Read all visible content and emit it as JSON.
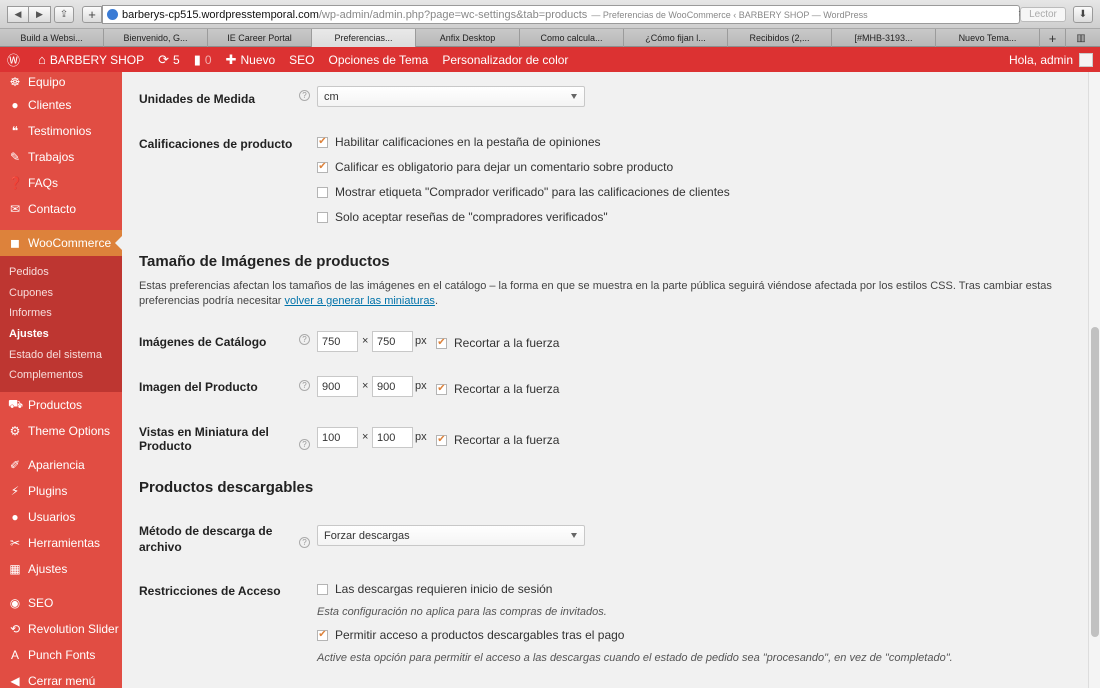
{
  "browser": {
    "url_host": "barberys-cp515.wordpresstemporal.com",
    "url_path": "/wp-admin/admin.php?page=wc-settings&tab=products",
    "page_title": "— Preferencias de WooCommerce ‹ BARBERY SHOP — WordPress",
    "reader_label": "Lector",
    "tabs": [
      "Build a Websi...",
      "Bienvenido, G...",
      "IE Career Portal",
      "Preferencias...",
      "Anfix Desktop",
      "Como calcula...",
      "¿Cómo fijan l...",
      "Recibidos (2,...",
      "[#MHB-3193...",
      "Nuevo Tema..."
    ]
  },
  "adminbar": {
    "site_name": "BARBERY SHOP",
    "updates_count": "5",
    "comments_count": "0",
    "new_label": "Nuevo",
    "seo_label": "SEO",
    "theme_options_label": "Opciones de Tema",
    "color_label": "Personalizador de color",
    "greeting": "Hola, admin"
  },
  "sidebar": {
    "top_items": [
      {
        "label": "Equipo",
        "icon": "group-icon"
      },
      {
        "label": "Clientes",
        "icon": "person-icon"
      },
      {
        "label": "Testimonios",
        "icon": "quote-icon"
      },
      {
        "label": "Trabajos",
        "icon": "pen-icon"
      },
      {
        "label": "FAQs",
        "icon": "help-icon"
      },
      {
        "label": "Contacto",
        "icon": "mail-icon"
      }
    ],
    "woocommerce": "WooCommerce",
    "sub_items": [
      "Pedidos",
      "Cupones",
      "Informes",
      "Ajustes",
      "Estado del sistema",
      "Complementos"
    ],
    "mid_items": [
      {
        "label": "Productos",
        "icon": "cart-icon"
      },
      {
        "label": "Theme Options",
        "icon": "gear-icon"
      }
    ],
    "bottom_items": [
      {
        "label": "Apariencia",
        "icon": "brush-icon"
      },
      {
        "label": "Plugins",
        "icon": "plug-icon"
      },
      {
        "label": "Usuarios",
        "icon": "person-icon"
      },
      {
        "label": "Herramientas",
        "icon": "wrench-icon"
      },
      {
        "label": "Ajustes",
        "icon": "settings-icon"
      }
    ],
    "extra_items": [
      {
        "label": "SEO",
        "icon": "seo-icon"
      },
      {
        "label": "Revolution Slider",
        "icon": "refresh-icon"
      },
      {
        "label": "Punch Fonts",
        "icon": "font-icon"
      },
      {
        "label": "Cerrar menú",
        "icon": "collapse-icon"
      }
    ]
  },
  "content": {
    "units_label": "Unidades de Medida",
    "units_value": "cm",
    "ratings_label": "Calificaciones de producto",
    "ratings": [
      {
        "label": "Habilitar calificaciones en la pestaña de opiniones",
        "checked": true
      },
      {
        "label": "Calificar es obligatorio para dejar un comentario sobre producto",
        "checked": true
      },
      {
        "label": "Mostrar etiqueta \"Comprador verificado\" para las calificaciones de clientes",
        "checked": false
      },
      {
        "label": "Solo aceptar reseñas de \"compradores verificados\"",
        "checked": false
      }
    ],
    "images_title": "Tamaño de Imágenes de productos",
    "images_desc": "Estas preferencias afectan los tamaños de las imágenes en el catálogo – la forma en que se muestra en la parte pública seguirá viéndose afectada por los estilos CSS. Tras cambiar estas preferencias podría necesitar ",
    "images_link": "volver a generar las miniaturas",
    "images_desc_end": ".",
    "times": "×",
    "px": "px",
    "crop_label": "Recortar a la fuerza",
    "image_rows": [
      {
        "label": "Imágenes de Catálogo",
        "width": "750",
        "height": "750"
      },
      {
        "label": "Imagen del Producto",
        "width": "900",
        "height": "900"
      },
      {
        "label": "Vistas en Miniatura del Producto",
        "width": "100",
        "height": "100"
      }
    ],
    "downloads_title": "Productos descargables",
    "download_method_label": "Método de descarga de archivo",
    "download_method_value": "Forzar descargas",
    "access_label": "Restricciones de Acceso",
    "access_1": "Las descargas requieren inicio de sesión",
    "access_1_note": "Esta configuración no aplica para las compras de invitados.",
    "access_2": "Permitir acceso a productos descargables tras el pago",
    "access_2_note": "Active esta opción para permitir el acceso a las descargas cuando el estado de pedido sea \"procesando\", en vez de \"completado\"."
  }
}
